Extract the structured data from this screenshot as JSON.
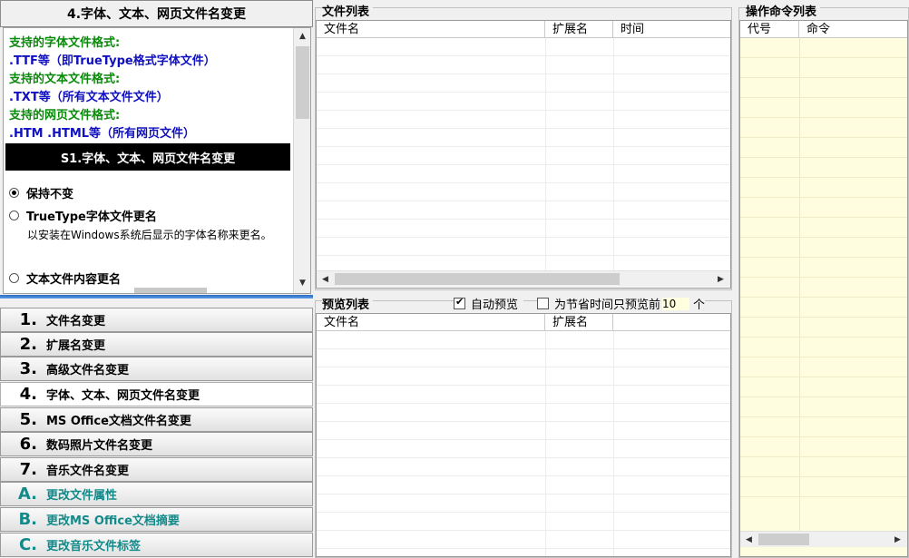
{
  "left": {
    "title": "4.字体、文本、网页文件名变更",
    "formats": [
      {
        "title": "支持的字体文件格式:",
        "desc": ".TTF等（即TrueType格式字体文件）"
      },
      {
        "title": "支持的文本文件格式:",
        "desc": ".TXT等（所有文本文件文件）"
      },
      {
        "title": "支持的网页文件格式:",
        "desc": ".HTM .HTML等（所有网页文件）"
      }
    ],
    "step_banner": "S1.字体、文本、网页文件名变更",
    "options": [
      {
        "label": "保持不变",
        "checked": true
      },
      {
        "label": "TrueType字体文件更名",
        "checked": false,
        "desc": "以安装在Windows系统后显示的字体名称来更名。"
      },
      {
        "label": "文本文件内容更名",
        "checked": false
      }
    ],
    "menu": [
      {
        "num": "1.",
        "label": "文件名变更"
      },
      {
        "num": "2.",
        "label": "扩展名变更"
      },
      {
        "num": "3.",
        "label": "高级文件名变更"
      },
      {
        "num": "4.",
        "label": "字体、文本、网页文件名变更"
      },
      {
        "num": "5.",
        "label": "MS Office文档文件名变更"
      },
      {
        "num": "6.",
        "label": "数码照片文件名变更"
      },
      {
        "num": "7.",
        "label": "音乐文件名变更"
      },
      {
        "num": "A.",
        "label": "更改文件属性"
      },
      {
        "num": "B.",
        "label": "更改MS Office文档摘要"
      },
      {
        "num": "C.",
        "label": "更改音乐文件标签"
      }
    ]
  },
  "file_list": {
    "title": "文件列表",
    "columns": [
      "文件名",
      "扩展名",
      "时间"
    ]
  },
  "preview": {
    "title": "预览列表",
    "auto_preview_label": "自动预览",
    "auto_preview": true,
    "limit_label": "为节省时间只预览前",
    "limit_value": "10",
    "limit_unit": "个",
    "limit_checked": false,
    "columns": [
      "文件名",
      "扩展名"
    ]
  },
  "commands": {
    "title": "操作命令列表",
    "columns": [
      "代号",
      "命令"
    ]
  }
}
